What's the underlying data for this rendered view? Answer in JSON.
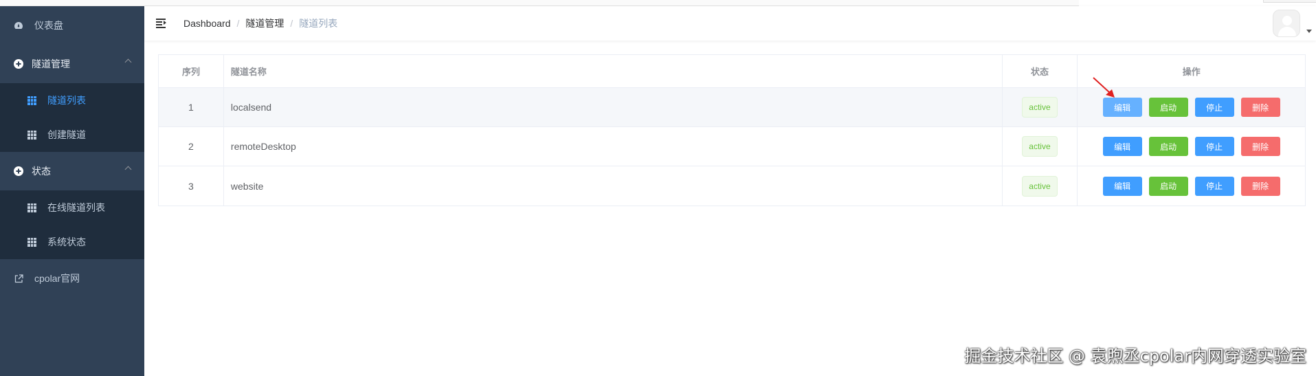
{
  "sidebar": {
    "dashboard": {
      "label": "仪表盘",
      "icon": "dashboard-icon"
    },
    "tunnel_mgmt": {
      "label": "隧道管理",
      "icon": "circle-plus-icon",
      "items": [
        {
          "label": "隧道列表",
          "active": true,
          "icon": "grid-icon"
        },
        {
          "label": "创建隧道",
          "active": false,
          "icon": "grid-icon"
        }
      ]
    },
    "status": {
      "label": "状态",
      "icon": "circle-plus-icon",
      "items": [
        {
          "label": "在线隧道列表",
          "icon": "grid-icon"
        },
        {
          "label": "系统状态",
          "icon": "grid-icon"
        }
      ]
    },
    "website": {
      "label": "cpolar官网",
      "icon": "external-link-icon"
    }
  },
  "breadcrumb": [
    "Dashboard",
    "隧道管理",
    "隧道列表"
  ],
  "breadcrumb_sep": "/",
  "table": {
    "columns": [
      "序列",
      "隧道名称",
      "状态",
      "操作"
    ],
    "rows": [
      {
        "index": "1",
        "name": "localsend",
        "status": "active"
      },
      {
        "index": "2",
        "name": "remoteDesktop",
        "status": "active"
      },
      {
        "index": "3",
        "name": "website",
        "status": "active"
      }
    ],
    "actions": {
      "edit": "编辑",
      "start": "启动",
      "stop": "停止",
      "delete": "删除"
    }
  },
  "watermark": "掘金技术社区 @ 袁煦丞cpolar内网穿透实验室",
  "colors": {
    "sidebar_bg": "#304156",
    "submenu_bg": "#1f2d3d",
    "primary": "#409eff",
    "success": "#67c23a",
    "danger": "#f56c6c",
    "annotation": "#e02020"
  }
}
